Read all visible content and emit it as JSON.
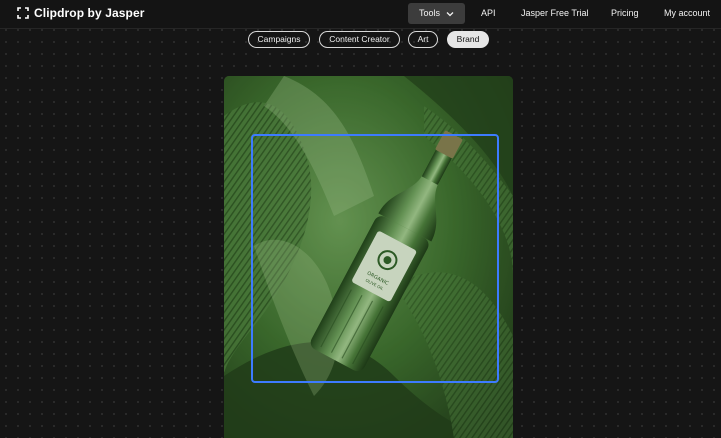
{
  "header": {
    "brand_name": "Clipdrop by Jasper",
    "brand_icon": "clipdrop-logo-icon",
    "nav": {
      "tools": "Tools",
      "api": "API",
      "trial": "Jasper Free Trial",
      "pricing": "Pricing",
      "account": "My account"
    }
  },
  "categories": {
    "campaigns": "Campaigns",
    "content_creator": "Content Creator",
    "art": "Art",
    "brand": "Brand",
    "selected": "Brand"
  },
  "label": {
    "line1": "ORGANIC",
    "line2": "OLIVE OIL"
  },
  "colors": {
    "background": "#151515",
    "selection_border": "#3d7bff",
    "image_tint": "#3d6b2e",
    "active_chip": "#e6e6e6"
  }
}
